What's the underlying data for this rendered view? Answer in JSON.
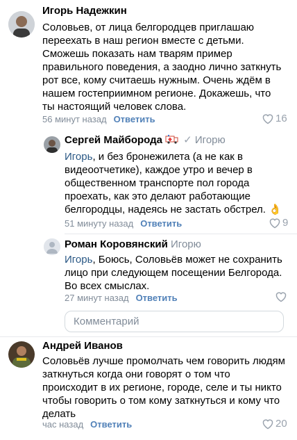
{
  "comments": [
    {
      "author": "Игорь Надежкин",
      "lines": [
        "Соловьев, от лица белгородцев приглашаю",
        "переехать в наш регион вместе с детьми.",
        "Сможешь показать нам тварям пример",
        "правильного поведения, а заодно лично заткнуть",
        "рот все, кому считаешь нужным. Очень ждём в",
        "нашем гостеприимном регионе. Докажешь, что",
        "ты настоящий человек слова."
      ],
      "time": "56 минут назад",
      "reply": "Ответить",
      "likes": "16"
    },
    {
      "author": "Сергей Майборода",
      "reply_to": "Игорю",
      "mention": "Игорь",
      "lines": [
        ", и без бронежилета (а не как в",
        "видеоотчетике), каждое утро и вечер в",
        "общественном транспорте пол города",
        "проехать, как это делают работающие",
        "белгородцы, надеясь не застать обстрел."
      ],
      "emoji": "👌",
      "time": "51 минуту назад",
      "reply": "Ответить",
      "likes": "9"
    },
    {
      "author": "Роман Коровянский",
      "reply_to": "Игорю",
      "mention": "Игорь",
      "lines": [
        ", Боюсь, Соловьёв может не сохранить",
        "лицо при следующем посещении Белгорода.",
        "Во всех смыслах."
      ],
      "time": "27 минут назад",
      "reply": "Ответить",
      "likes": ""
    },
    {
      "author": "Андрей Иванов",
      "lines": [
        "Соловьёв лучше промолчать чем говорить людям",
        "заткнуться когда они говорят о том что",
        "происходит в их регионе, городе, селе и ты никто",
        "чтобы говорить о том кому заткнуться и кому что",
        "делать"
      ],
      "time": "час назад",
      "reply": "Ответить",
      "likes": "20"
    }
  ],
  "input": {
    "placeholder": "Комментарий"
  },
  "colors": {
    "link": "#5181b8",
    "meta": "#818c99",
    "mention": "#2a5885"
  }
}
